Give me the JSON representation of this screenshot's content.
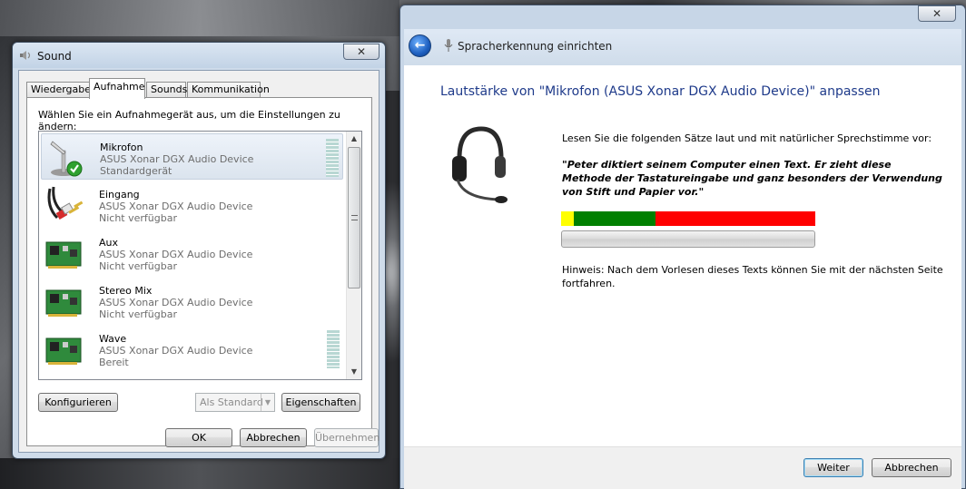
{
  "sound_dialog": {
    "title": "Sound",
    "close_label": "✕",
    "tabs": [
      {
        "label": "Wiedergabe",
        "active": false
      },
      {
        "label": "Aufnahme",
        "active": true
      },
      {
        "label": "Sounds",
        "active": false
      },
      {
        "label": "Kommunikation",
        "active": false
      }
    ],
    "instruction": "Wählen Sie ein Aufnahmegerät aus, um die Einstellungen zu ändern:",
    "devices": [
      {
        "name": "Mikrofon",
        "device": "ASUS Xonar DGX Audio Device",
        "status": "Standardgerät",
        "icon": "microphone-icon",
        "selected": true
      },
      {
        "name": "Eingang",
        "device": "ASUS Xonar DGX Audio Device",
        "status": "Nicht verfügbar",
        "icon": "rca-cable-icon",
        "selected": false
      },
      {
        "name": "Aux",
        "device": "ASUS Xonar DGX Audio Device",
        "status": "Nicht verfügbar",
        "icon": "sound-card-icon",
        "selected": false
      },
      {
        "name": "Stereo Mix",
        "device": "ASUS Xonar DGX Audio Device",
        "status": "Nicht verfügbar",
        "icon": "sound-card-icon",
        "selected": false
      },
      {
        "name": "Wave",
        "device": "ASUS Xonar DGX Audio Device",
        "status": "Bereit",
        "icon": "sound-card-icon",
        "selected": false
      }
    ],
    "buttons": {
      "configure": "Konfigurieren",
      "set_default": "Als Standard",
      "properties": "Eigenschaften",
      "ok": "OK",
      "cancel": "Abbrechen",
      "apply": "Übernehmen"
    }
  },
  "speech_wizard": {
    "header_title": "Spracherkennung einrichten",
    "close_label": "✕",
    "back_label": "←",
    "main_title": "Lautstärke von \"Mikrofon (ASUS Xonar DGX Audio Device)\" anpassen",
    "instruction": "Lesen Sie die folgenden Sätze laut und mit natürlicher Sprechstimme vor:",
    "quote": "\"Peter diktiert seinem Computer einen Text. Er zieht diese Methode der Tastatureingabe und ganz besonders der Verwendung von Stift und Papier vor.\"",
    "level_segments": [
      {
        "color": "#ffff00",
        "fraction": 0.05
      },
      {
        "color": "#008000",
        "fraction": 0.32
      },
      {
        "color": "#ff0000",
        "fraction": 0.63
      }
    ],
    "progress_fraction": 0,
    "hint": "Hinweis: Nach dem Vorlesen dieses Texts können Sie mit der nächsten Seite fortfahren.",
    "buttons": {
      "next": "Weiter",
      "cancel": "Abbrechen"
    }
  }
}
